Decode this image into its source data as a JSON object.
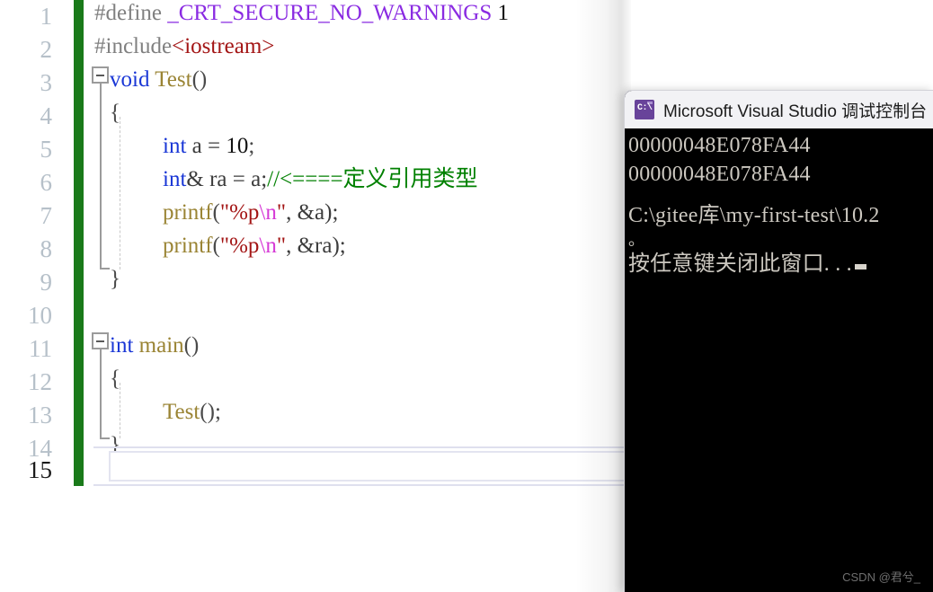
{
  "editor": {
    "line_numbers": [
      "1",
      "2",
      "3",
      "4",
      "5",
      "6",
      "7",
      "8",
      "9",
      "10",
      "11",
      "12",
      "13",
      "14",
      "15"
    ],
    "current_line": "15",
    "lines": [
      {
        "n": 1,
        "text": "#define _CRT_SECURE_NO_WARNINGS 1"
      },
      {
        "n": 2,
        "text": "#include<iostream>"
      },
      {
        "n": 3,
        "text": "void Test()"
      },
      {
        "n": 4,
        "text": "{"
      },
      {
        "n": 5,
        "text": "    int a = 10;"
      },
      {
        "n": 6,
        "text": "    int& ra = a;//<====定义引用类型"
      },
      {
        "n": 7,
        "text": "    printf(\"%p\\n\", &a);"
      },
      {
        "n": 8,
        "text": "    printf(\"%p\\n\", &ra);"
      },
      {
        "n": 9,
        "text": "}"
      },
      {
        "n": 10,
        "text": ""
      },
      {
        "n": 11,
        "text": "int main()"
      },
      {
        "n": 12,
        "text": "{"
      },
      {
        "n": 13,
        "text": "    Test();"
      },
      {
        "n": 14,
        "text": "}"
      },
      {
        "n": 15,
        "text": ""
      }
    ],
    "tokens": {
      "l1_define": "#define",
      "l1_macro": " _CRT_SECURE_NO_WARNINGS",
      "l1_value": " 1",
      "l2_include": "#include",
      "l2_header": "<iostream>",
      "l3_kw": "void",
      "l3_fn": " Test",
      "l3_punct": "()",
      "l4_brace": "{",
      "l5_kw": "int",
      "l5_rest": " a = ",
      "l5_num": "10",
      "l5_semi": ";",
      "l6_kw": "int",
      "l6_amp": "&",
      "l6_rest": " ra = a;",
      "l6_comment": "//<====定义引用类型",
      "l7_fn": "printf",
      "l7_open": "(",
      "l7_str_a": "\"%p",
      "l7_esc": "\\n",
      "l7_str_b": "\"",
      "l7_args": ", &a);",
      "l8_fn": "printf",
      "l8_open": "(",
      "l8_str_a": "\"%p",
      "l8_esc": "\\n",
      "l8_str_b": "\"",
      "l8_args": ", &ra);",
      "l9_brace": "}",
      "l11_kw": "int",
      "l11_fn": " main",
      "l11_punct": "()",
      "l12_brace": "{",
      "l13_fn": "Test",
      "l13_punct": "();",
      "l14_brace": "}"
    },
    "colors": {
      "preprocessor": "#808080",
      "macro": "#8a2be2",
      "keyword": "#1a37d6",
      "string": "#a31515",
      "escape": "#d63ad6",
      "function": "#9a8434",
      "comment": "#008000",
      "change_bar": "#1a7a1a",
      "line_number": "#b6c0c9"
    },
    "fold_markers": [
      "collapse-minus-line-3",
      "collapse-minus-line-11"
    ]
  },
  "console": {
    "title": "Microsoft Visual Studio 调试控制台",
    "icon": "console-app-icon",
    "icon_glyph": "C:\\",
    "output": [
      "00000048E078FA44",
      "00000048E078FA44",
      "",
      "C:\\gitee库\\my-first-test\\10.2",
      "。",
      "按任意键关闭此窗口. . ."
    ],
    "background": "#000000",
    "text_color": "#ccc8c0",
    "titlebar_color": "#f2f2f5"
  },
  "watermark": {
    "text": "CSDN @君兮_"
  }
}
